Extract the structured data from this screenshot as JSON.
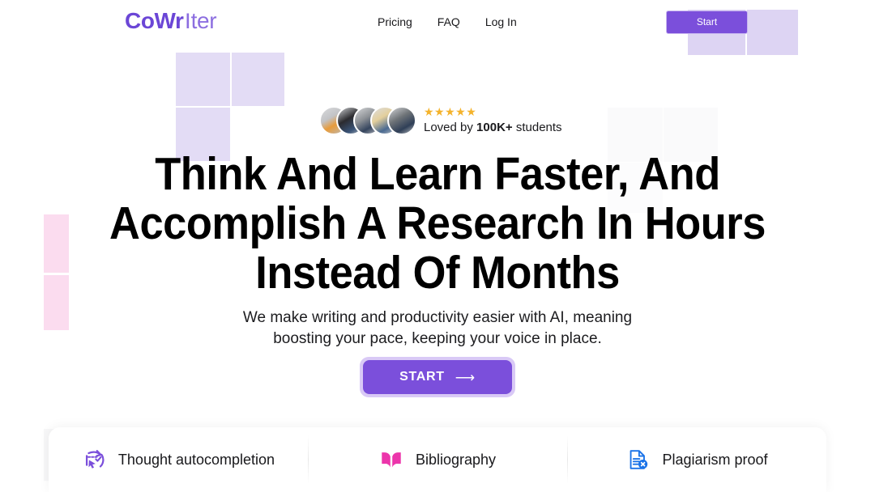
{
  "header": {
    "logo": {
      "strong": "CoWr",
      "cursor": "I",
      "rest": "ter"
    },
    "nav": [
      {
        "label": "Pricing",
        "name": "nav-pricing"
      },
      {
        "label": "FAQ",
        "name": "nav-faq"
      },
      {
        "label": "Log In",
        "name": "nav-login"
      }
    ],
    "start_button": "Start"
  },
  "social_proof": {
    "stars": "★★★★★",
    "star_count": 5,
    "loved_prefix": "Loved by ",
    "loved_count": "100K+",
    "loved_suffix": " students",
    "avatar_count": 5
  },
  "hero": {
    "headline_lines": [
      "Think And Learn Faster, And",
      "Accomplish A Research In Hours",
      "Instead Of Months"
    ],
    "subheading_lines": [
      "We make writing and productivity easier with AI, meaning",
      "boosting your pace, keeping your voice in place."
    ],
    "cta_label": "START",
    "cta_arrow": "⟶"
  },
  "features": [
    {
      "label": "Thought autocompletion",
      "icon": "autocomplete-cursor-icon",
      "color": "#7b4fdb"
    },
    {
      "label": "Bibliography",
      "icon": "open-book-icon",
      "color": "#ec35ab"
    },
    {
      "label": "Plagiarism proof",
      "icon": "document-x-icon",
      "color": "#1a73e8"
    }
  ],
  "colors": {
    "brand_purple": "#7b4fdb",
    "logo_purple": "#6b46d6",
    "logo_light_purple": "#8c6ee0",
    "lavender_block": "#e3dcf5",
    "lavender_block_dark": "#ddd4f3",
    "pink_block": "#fbdcef",
    "grey_block": "#fafafb",
    "star_gold": "#f4b32c",
    "pink_accent": "#ec35ab",
    "blue_accent": "#1a73e8",
    "text_dark": "#17171a"
  }
}
